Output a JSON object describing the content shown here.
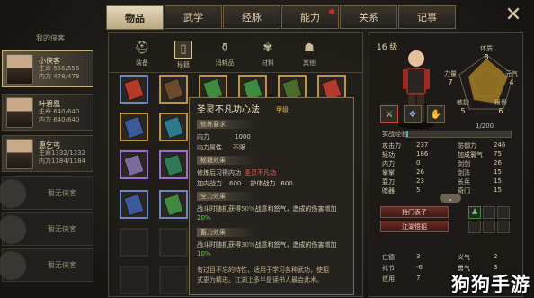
{
  "tabs": [
    {
      "label": "物品",
      "active": true
    },
    {
      "label": "武学"
    },
    {
      "label": "经脉"
    },
    {
      "label": "能力",
      "badge": true
    },
    {
      "label": "关系"
    },
    {
      "label": "记事"
    }
  ],
  "close_icon": "close-x-icon",
  "party": {
    "title": "我的侠客",
    "members": [
      {
        "name": "小侠客",
        "hp": "生命 556/556",
        "mp": "内力 478/478"
      },
      {
        "name": "叶碧凰",
        "hp": "生命 640/640",
        "mp": "内力 640/640"
      },
      {
        "name": "惠乞丐",
        "hp": "生命1332/1332",
        "mp": "内力1184/1184"
      }
    ],
    "empty_label": "暂无侠客"
  },
  "categories": [
    {
      "label": "装备",
      "icon": "helmet-icon",
      "glyph": "⛑"
    },
    {
      "label": "秘籍",
      "icon": "book-icon",
      "glyph": "▯",
      "active": true
    },
    {
      "label": "消耗品",
      "icon": "potion-icon",
      "glyph": "⚱"
    },
    {
      "label": "材料",
      "icon": "herb-icon",
      "glyph": "✾"
    },
    {
      "label": "其他",
      "icon": "pouch-icon",
      "glyph": "☗"
    }
  ],
  "colors": {
    "blue": "#6b86c2",
    "gold": "#c0943e",
    "purple": "#9a6fd0",
    "accent_red": "#d0281e"
  },
  "tooltip": {
    "title": "圣灵不凡功心法",
    "grade": "甲级",
    "sec_req": "修炼要求",
    "req_neili": "内力",
    "req_neili_val": "1000",
    "req_attr": "内力属性",
    "req_attr_val": "不限",
    "sec_effect": "秘籍效果",
    "effect_learn": "修炼后习得内功",
    "effect_learn_val": "圣灵不凡功",
    "neili_label": "加内战力",
    "neili_val": "600",
    "def_label": "护体战力",
    "def_val": "600",
    "sec_passive1": "全力效果",
    "passive1_a": "战斗时随机获得",
    "passive1_pct": "50%",
    "passive1_b": "战意和怒气，造成的伤害增加",
    "passive1_c": "20%",
    "sec_passive2": "蓄力效果",
    "passive2_a": "战斗时随机获得",
    "passive2_pct": "30%",
    "passive2_b": "战意和怒气，造成的伤害增加",
    "passive2_c": "10%",
    "desc1": "有过目不忘的特性，适用于学习各种武功，使招",
    "desc2": "式更为精进。江湖上多半是读书人最会此术。"
  },
  "hero": {
    "level": "16 级",
    "radar": {
      "tizhi": {
        "label": "体质",
        "val": "8"
      },
      "liliang": {
        "label": "力量",
        "val": "7"
      },
      "yuanqi": {
        "label": "元气",
        "val": "4"
      },
      "minjie": {
        "label": "敏捷",
        "val": "5"
      },
      "gengu": {
        "label": "根骨",
        "val": "6"
      }
    },
    "exp_label": "实战经验",
    "exp_val": "1/200",
    "exp_fraction": 0.005,
    "stats_left": [
      {
        "k": "攻击力",
        "v": "237"
      },
      {
        "k": "轻功",
        "v": "186"
      },
      {
        "k": "内力",
        "v": "0"
      },
      {
        "k": "掌掌",
        "v": "26"
      },
      {
        "k": "耍刀",
        "v": "23"
      },
      {
        "k": "暗器",
        "v": "5"
      }
    ],
    "stats_right": [
      {
        "k": "防御力",
        "v": "246"
      },
      {
        "k": "加成氯气",
        "v": "75"
      },
      {
        "k": "剑剑",
        "v": "26"
      },
      {
        "k": "剑法",
        "v": "15"
      },
      {
        "k": "长兵",
        "v": "15"
      },
      {
        "k": "奇门",
        "v": "15"
      }
    ],
    "btn1": "拾门表子",
    "btn2": "江湖悟招",
    "bottom_left": [
      {
        "k": "仁德",
        "v": "3"
      },
      {
        "k": "礼节",
        "v": "-6"
      },
      {
        "k": "信用",
        "v": "7"
      }
    ],
    "bottom_right": [
      {
        "k": "义气",
        "v": "2"
      },
      {
        "k": "勇气",
        "v": "3"
      }
    ]
  },
  "watermark": "狗狗手游"
}
